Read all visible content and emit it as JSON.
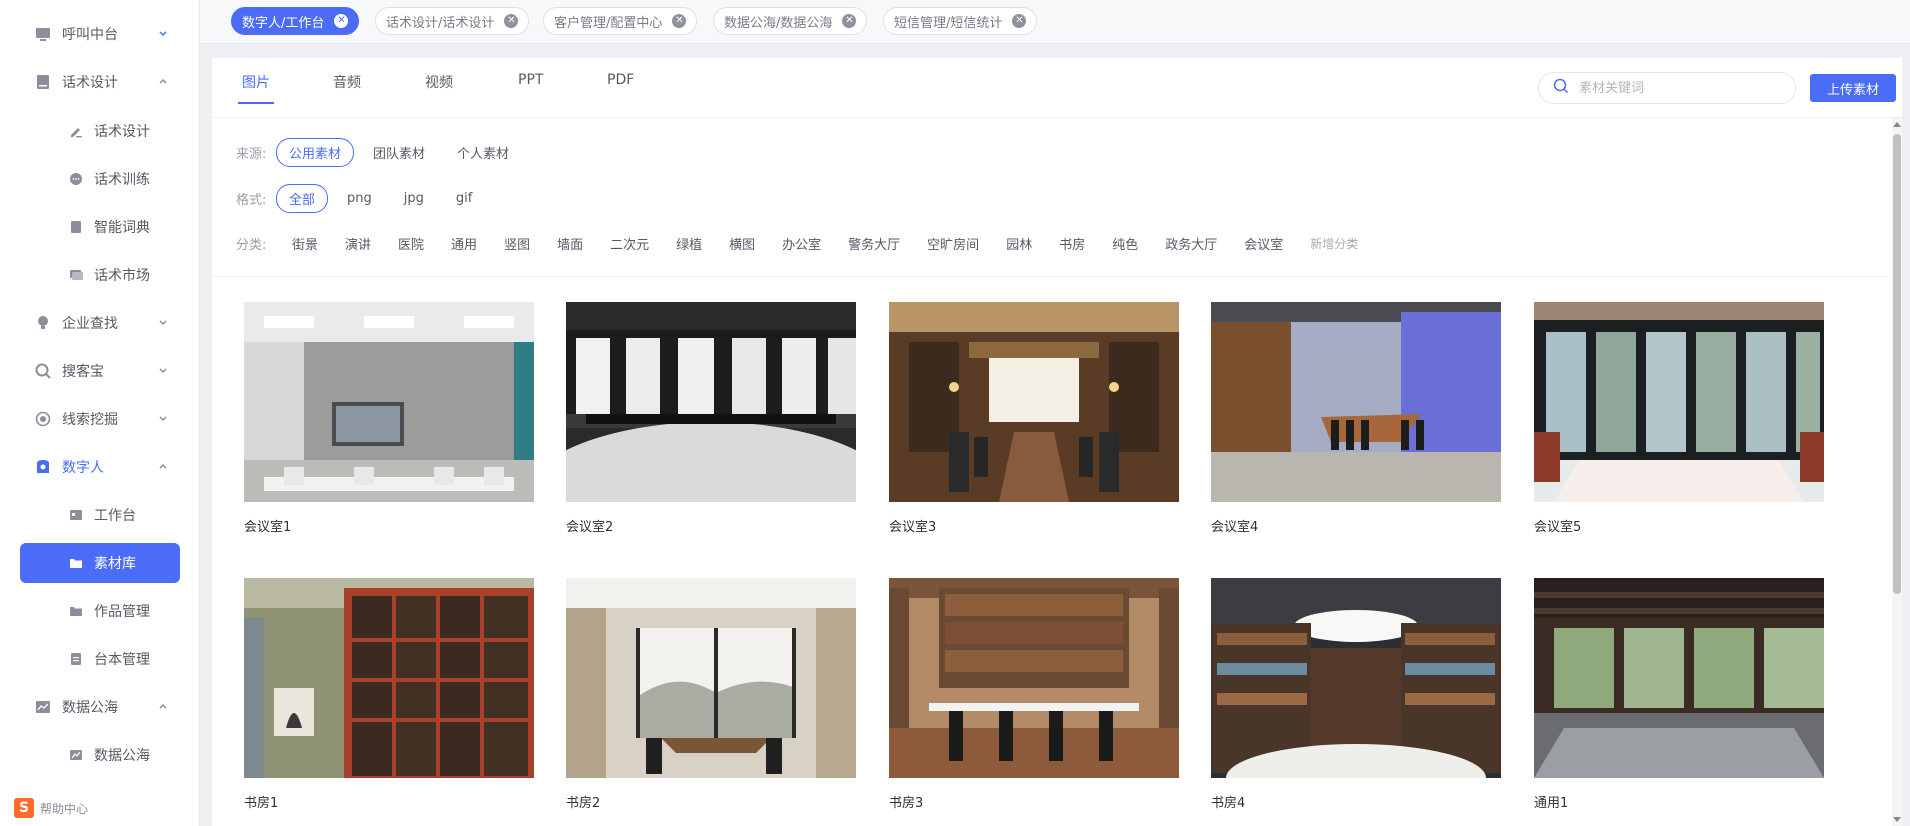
{
  "sidebar": {
    "items": [
      {
        "label": "呼叫中台"
      },
      {
        "label": "话术设计"
      },
      {
        "label": "话术设计"
      },
      {
        "label": "话术训练"
      },
      {
        "label": "智能词典"
      },
      {
        "label": "话术市场"
      },
      {
        "label": "企业查找"
      },
      {
        "label": "搜客宝"
      },
      {
        "label": "线索挖掘"
      },
      {
        "label": "数字人"
      },
      {
        "label": "工作台"
      },
      {
        "label": "素材库"
      },
      {
        "label": "作品管理"
      },
      {
        "label": "台本管理"
      },
      {
        "label": "数据公海"
      },
      {
        "label": "数据公海"
      }
    ],
    "help_label": "帮助中心",
    "logo_letter": "S"
  },
  "tags": [
    {
      "label": "数字人/工作台"
    },
    {
      "label": "话术设计/话术设计"
    },
    {
      "label": "客户管理/配置中心"
    },
    {
      "label": "数据公海/数据公海"
    },
    {
      "label": "短信管理/短信统计"
    }
  ],
  "type_tabs": [
    "图片",
    "音频",
    "视频",
    "PPT",
    "PDF"
  ],
  "search": {
    "placeholder": "素材关键词"
  },
  "upload_label": "上传素材",
  "filters": {
    "source_label": "来源:",
    "source_options": [
      "公用素材",
      "团队素材",
      "个人素材"
    ],
    "format_label": "格式:",
    "format_options": [
      "全部",
      "png",
      "jpg",
      "gif"
    ],
    "category_label": "分类:",
    "categories": [
      "街景",
      "演讲",
      "医院",
      "通用",
      "竖图",
      "墙面",
      "二次元",
      "绿植",
      "横图",
      "办公室",
      "警务大厅",
      "空旷房间",
      "园林",
      "书房",
      "纯色",
      "政务大厅",
      "会议室"
    ],
    "add_category_label": "新增分类"
  },
  "materials": [
    {
      "name": "会议室1"
    },
    {
      "name": "会议室2"
    },
    {
      "name": "会议室3"
    },
    {
      "name": "会议室4"
    },
    {
      "name": "会议室5"
    },
    {
      "name": "书房1"
    },
    {
      "name": "书房2"
    },
    {
      "name": "书房3"
    },
    {
      "name": "书房4"
    },
    {
      "name": "通用1"
    }
  ],
  "colors": {
    "accent": "#4a6cf7"
  }
}
